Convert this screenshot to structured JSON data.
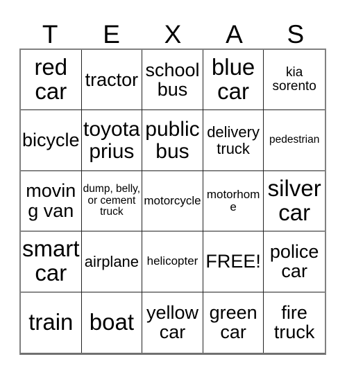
{
  "card": {
    "title_letters": [
      "T",
      "E",
      "X",
      "A",
      "S"
    ],
    "grid": {
      "rows": 5,
      "columns": 5,
      "cells": [
        {
          "text": "red car",
          "size": "fs-xxl"
        },
        {
          "text": "tractor",
          "size": "fs-l"
        },
        {
          "text": "school bus",
          "size": "fs-l"
        },
        {
          "text": "blue car",
          "size": "fs-xxl"
        },
        {
          "text": "kia sorento",
          "size": "fs-s"
        },
        {
          "text": "bicycle",
          "size": "fs-l"
        },
        {
          "text": "toyota prius",
          "size": "fs-xl"
        },
        {
          "text": "public bus",
          "size": "fs-xl"
        },
        {
          "text": "delivery truck",
          "size": "fs-m"
        },
        {
          "text": "pedestrian",
          "size": "fs-xxs"
        },
        {
          "text": "moving van",
          "size": "fs-l"
        },
        {
          "text": "dump, belly, or cement truck",
          "size": "fs-xxs"
        },
        {
          "text": "motorcycle",
          "size": "fs-xs"
        },
        {
          "text": "motorhome",
          "size": "fs-xs"
        },
        {
          "text": "silver car",
          "size": "fs-xxl"
        },
        {
          "text": "smart car",
          "size": "fs-xxl"
        },
        {
          "text": "airplane",
          "size": "fs-m"
        },
        {
          "text": "helicopter",
          "size": "fs-xs"
        },
        {
          "text": "FREE!",
          "size": "fs-l"
        },
        {
          "text": "police car",
          "size": "fs-l"
        },
        {
          "text": "train",
          "size": "fs-xxl"
        },
        {
          "text": "boat",
          "size": "fs-xxl"
        },
        {
          "text": "yellow car",
          "size": "fs-l"
        },
        {
          "text": "green car",
          "size": "fs-l"
        },
        {
          "text": "fire truck",
          "size": "fs-l"
        }
      ]
    },
    "colors": {
      "background": "#ffffff",
      "text": "#000000",
      "grid_line": "#222222",
      "outer_border": "#808080"
    }
  }
}
